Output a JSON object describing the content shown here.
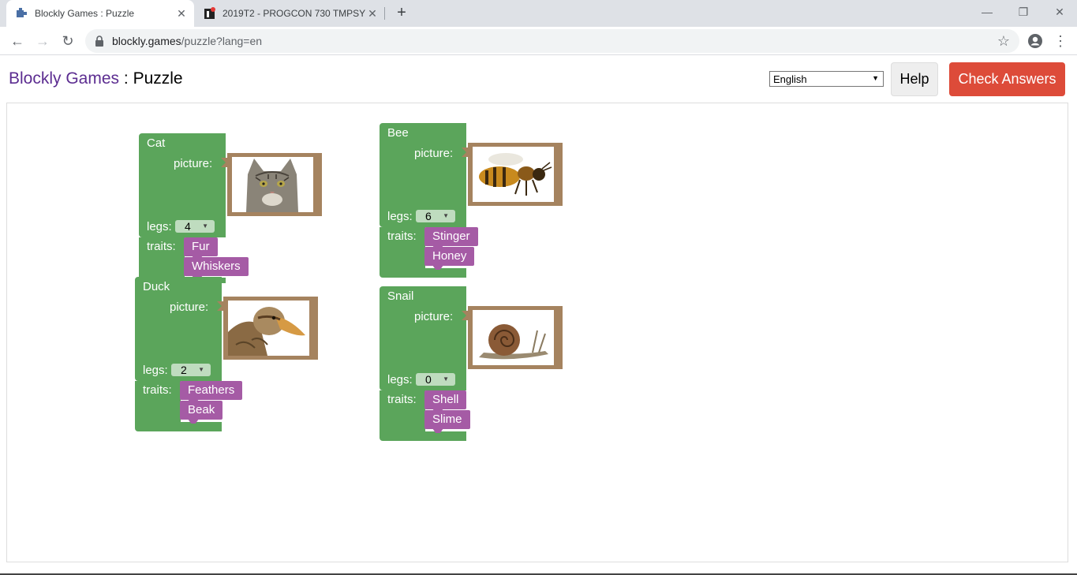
{
  "browser": {
    "tabs": [
      {
        "title": "Blockly Games : Puzzle",
        "active": true
      },
      {
        "title": "2019T2 - PROGCON 730 TMPSY | ",
        "active": false
      }
    ],
    "url_host": "blockly.games",
    "url_path": "/puzzle?lang=en",
    "icons": [
      "puzzle-favicon",
      "close-icon",
      "new-tab-icon",
      "minimize-icon",
      "restore-icon",
      "close-window-icon",
      "back-icon",
      "forward-icon",
      "reload-icon",
      "lock-icon",
      "bookmark-star-icon",
      "account-icon",
      "menu-icon"
    ]
  },
  "header": {
    "brand": "Blockly Games",
    "separator": " : ",
    "title": "Puzzle",
    "language": "English",
    "help_label": "Help",
    "check_label": "Check Answers"
  },
  "labels": {
    "picture": "picture:",
    "legs": "legs:",
    "traits": "traits:"
  },
  "animals": [
    {
      "name": "Cat",
      "legs": "4",
      "traits": [
        "Fur",
        "Whiskers"
      ],
      "picture": "cat"
    },
    {
      "name": "Bee",
      "legs": "6",
      "traits": [
        "Stinger",
        "Honey"
      ],
      "picture": "bee"
    },
    {
      "name": "Duck",
      "legs": "2",
      "traits": [
        "Feathers",
        "Beak"
      ],
      "picture": "duck"
    },
    {
      "name": "Snail",
      "legs": "0",
      "traits": [
        "Shell",
        "Slime"
      ],
      "picture": "snail"
    }
  ],
  "colors": {
    "animal_block": "#5ba55b",
    "trait_block": "#a55ba5",
    "picture_block": "#a5835f",
    "check_button": "#dd4b39",
    "brand": "#5c2d91"
  }
}
